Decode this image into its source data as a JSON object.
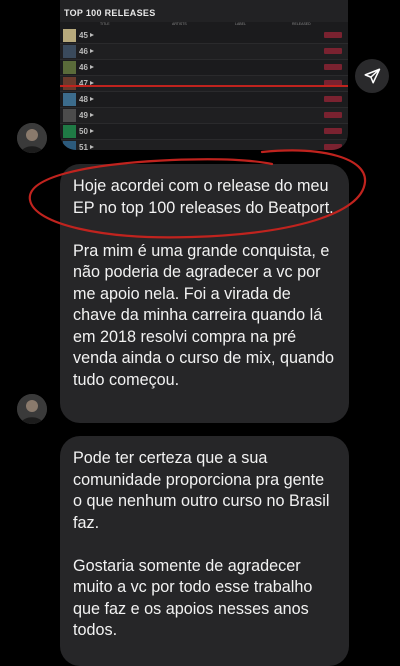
{
  "attachment": {
    "title": "TOP 100 RELEASES",
    "columns": [
      "TITLE",
      "ARTISTS",
      "LABEL",
      "RELEASED"
    ],
    "rows": [
      {
        "rank": "45",
        "art_color": "#b7a97c"
      },
      {
        "rank": "46",
        "art_color": "#3a4a5c"
      },
      {
        "rank": "46",
        "art_color": "#5a6b3a"
      },
      {
        "rank": "47",
        "art_color": "#6a3a2c"
      },
      {
        "rank": "48",
        "art_color": "#3c6c8c"
      },
      {
        "rank": "49",
        "art_color": "#4c4c4c"
      },
      {
        "rank": "50",
        "art_color": "#1f7a45"
      },
      {
        "rank": "51",
        "art_color": "#2c5a7c"
      }
    ]
  },
  "messages": [
    {
      "paragraphs": [
        "Hoje acordei com o release do meu EP no top 100 releases do Beatport.",
        "Pra mim é uma grande conquista, e não poderia de agradecer a vc por me apoio nela. Foi a virada de chave da minha carreira quando lá em 2018 resolvi compra na pré venda ainda o curso de mix, quando tudo começou."
      ]
    },
    {
      "paragraphs": [
        "Pode ter certeza que a sua comunidade proporciona pra gente o que nenhum outro curso no Brasil faz.",
        "Gostaria somente de agradecer muito a vc por todo esse trabalho que faz e os apoios nesses anos todos."
      ]
    }
  ],
  "colors": {
    "background": "#000000",
    "bubble": "#262628",
    "annotation": "#c0231e",
    "beatport_link": "#2fa9d6"
  },
  "icons": {
    "share": "paper-plane-icon",
    "avatar": "user-photo"
  }
}
